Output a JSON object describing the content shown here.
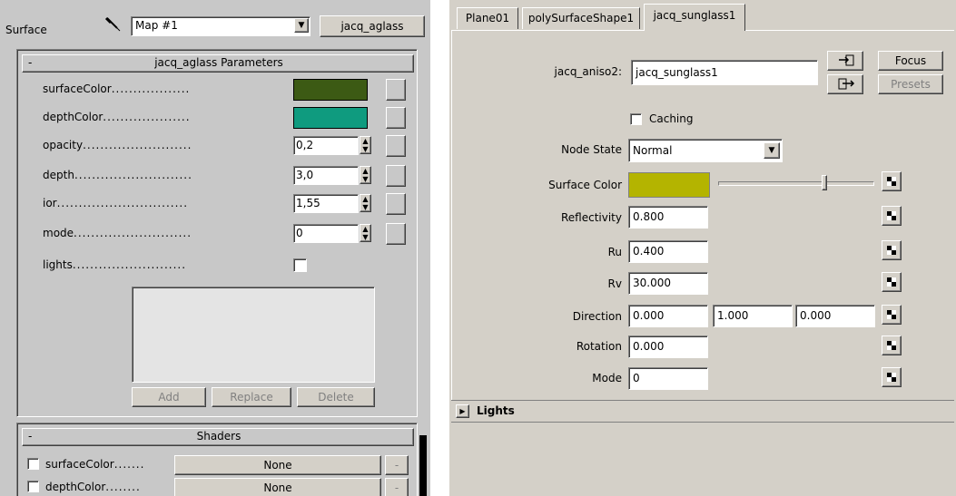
{
  "left_panel": {
    "surface_label": "Surface",
    "map_dropdown": "Map #1",
    "material_button": "jacq_aglass",
    "params_rollout": {
      "collapse_symbol": "-",
      "title": "jacq_aglass Parameters",
      "rows": [
        {
          "label": "surfaceColor",
          "dots": "..................",
          "type": "color",
          "color": "#3c5a14"
        },
        {
          "label": "depthColor",
          "dots": "....................",
          "type": "color",
          "color": "#0f9b7f"
        },
        {
          "label": "opacity",
          "dots": ".........................",
          "type": "spinner",
          "value": "0,2"
        },
        {
          "label": "depth",
          "dots": "...........................",
          "type": "spinner",
          "value": "3,0"
        },
        {
          "label": "ior",
          "dots": "..............................",
          "type": "spinner",
          "value": "1,55"
        },
        {
          "label": "mode",
          "dots": "...........................",
          "type": "spinner",
          "value": "0"
        },
        {
          "label": "lights",
          "dots": "..........................",
          "type": "checkbox",
          "checked": false
        }
      ],
      "add_button": "Add",
      "replace_button": "Replace",
      "delete_button": "Delete"
    },
    "shaders_rollout": {
      "collapse_symbol": "-",
      "title": "Shaders",
      "rows": [
        {
          "label": "surfaceColor",
          "dots": ".......",
          "value": "None",
          "side": "-"
        },
        {
          "label": "depthColor",
          "dots": "........",
          "value": "None",
          "side": "-"
        }
      ]
    }
  },
  "right_panel": {
    "tabs": [
      "Plane01",
      "polySurfaceShape1",
      "jacq_sunglass1"
    ],
    "node_label": "jacq_aniso2:",
    "node_name": "jacq_sunglass1",
    "focus_button": "Focus",
    "presets_button": "Presets",
    "caching_label": "Caching",
    "node_state_label": "Node State",
    "node_state_value": "Normal",
    "surface_color_label": "Surface Color",
    "surface_color": "#b4b400",
    "slider_value": 0.68,
    "attributes": [
      {
        "label": "Reflectivity",
        "value": "0.800"
      },
      {
        "label": "Ru",
        "value": "0.400"
      },
      {
        "label": "Rv",
        "value": "30.000"
      }
    ],
    "direction_label": "Direction",
    "direction_values": [
      "0.000",
      "1.000",
      "0.000"
    ],
    "rotation_label": "Rotation",
    "rotation_value": "0.000",
    "mode_label": "Mode",
    "mode_value": "0",
    "lights_section": "Lights",
    "expand_symbol": "▶"
  }
}
